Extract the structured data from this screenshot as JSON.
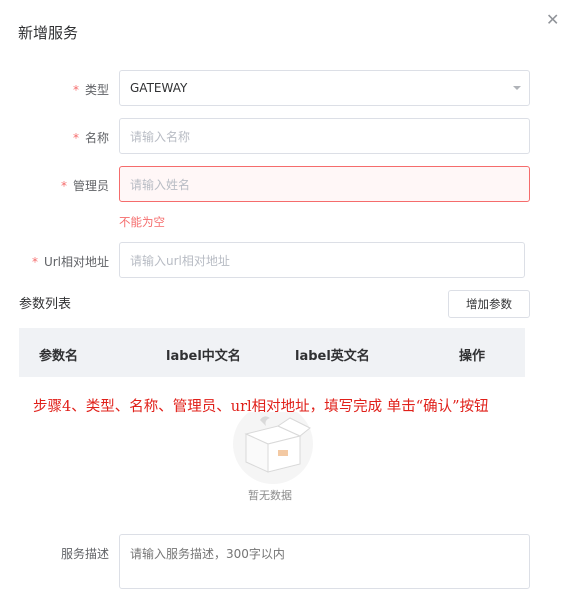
{
  "dialog": {
    "title": "新增服务",
    "close_icon": "close-icon"
  },
  "form": {
    "type": {
      "label": "类型",
      "required": "*",
      "value": "GATEWAY"
    },
    "name": {
      "label": "名称",
      "required": "*",
      "placeholder": "请输入名称"
    },
    "manager": {
      "label": "管理员",
      "required": "*",
      "placeholder": "请输入姓名",
      "error": "不能为空"
    },
    "url": {
      "label": "Url相对地址",
      "required": "*",
      "placeholder": "请输入url相对地址"
    },
    "description": {
      "label": "服务描述",
      "placeholder": "请输入服务描述，300字以内"
    }
  },
  "params": {
    "title": "参数列表",
    "add_button": "增加参数",
    "columns": [
      "参数名",
      "label中文名",
      "label英文名",
      "操作"
    ],
    "empty_text": "暂无数据"
  },
  "annotation": "步骤4、类型、名称、管理员、url相对地址，填写完成 单击“确认”按钮",
  "colors": {
    "error": "#f56c6c",
    "annotation": "#e0201a",
    "table_header_bg": "#f0f2f5"
  }
}
